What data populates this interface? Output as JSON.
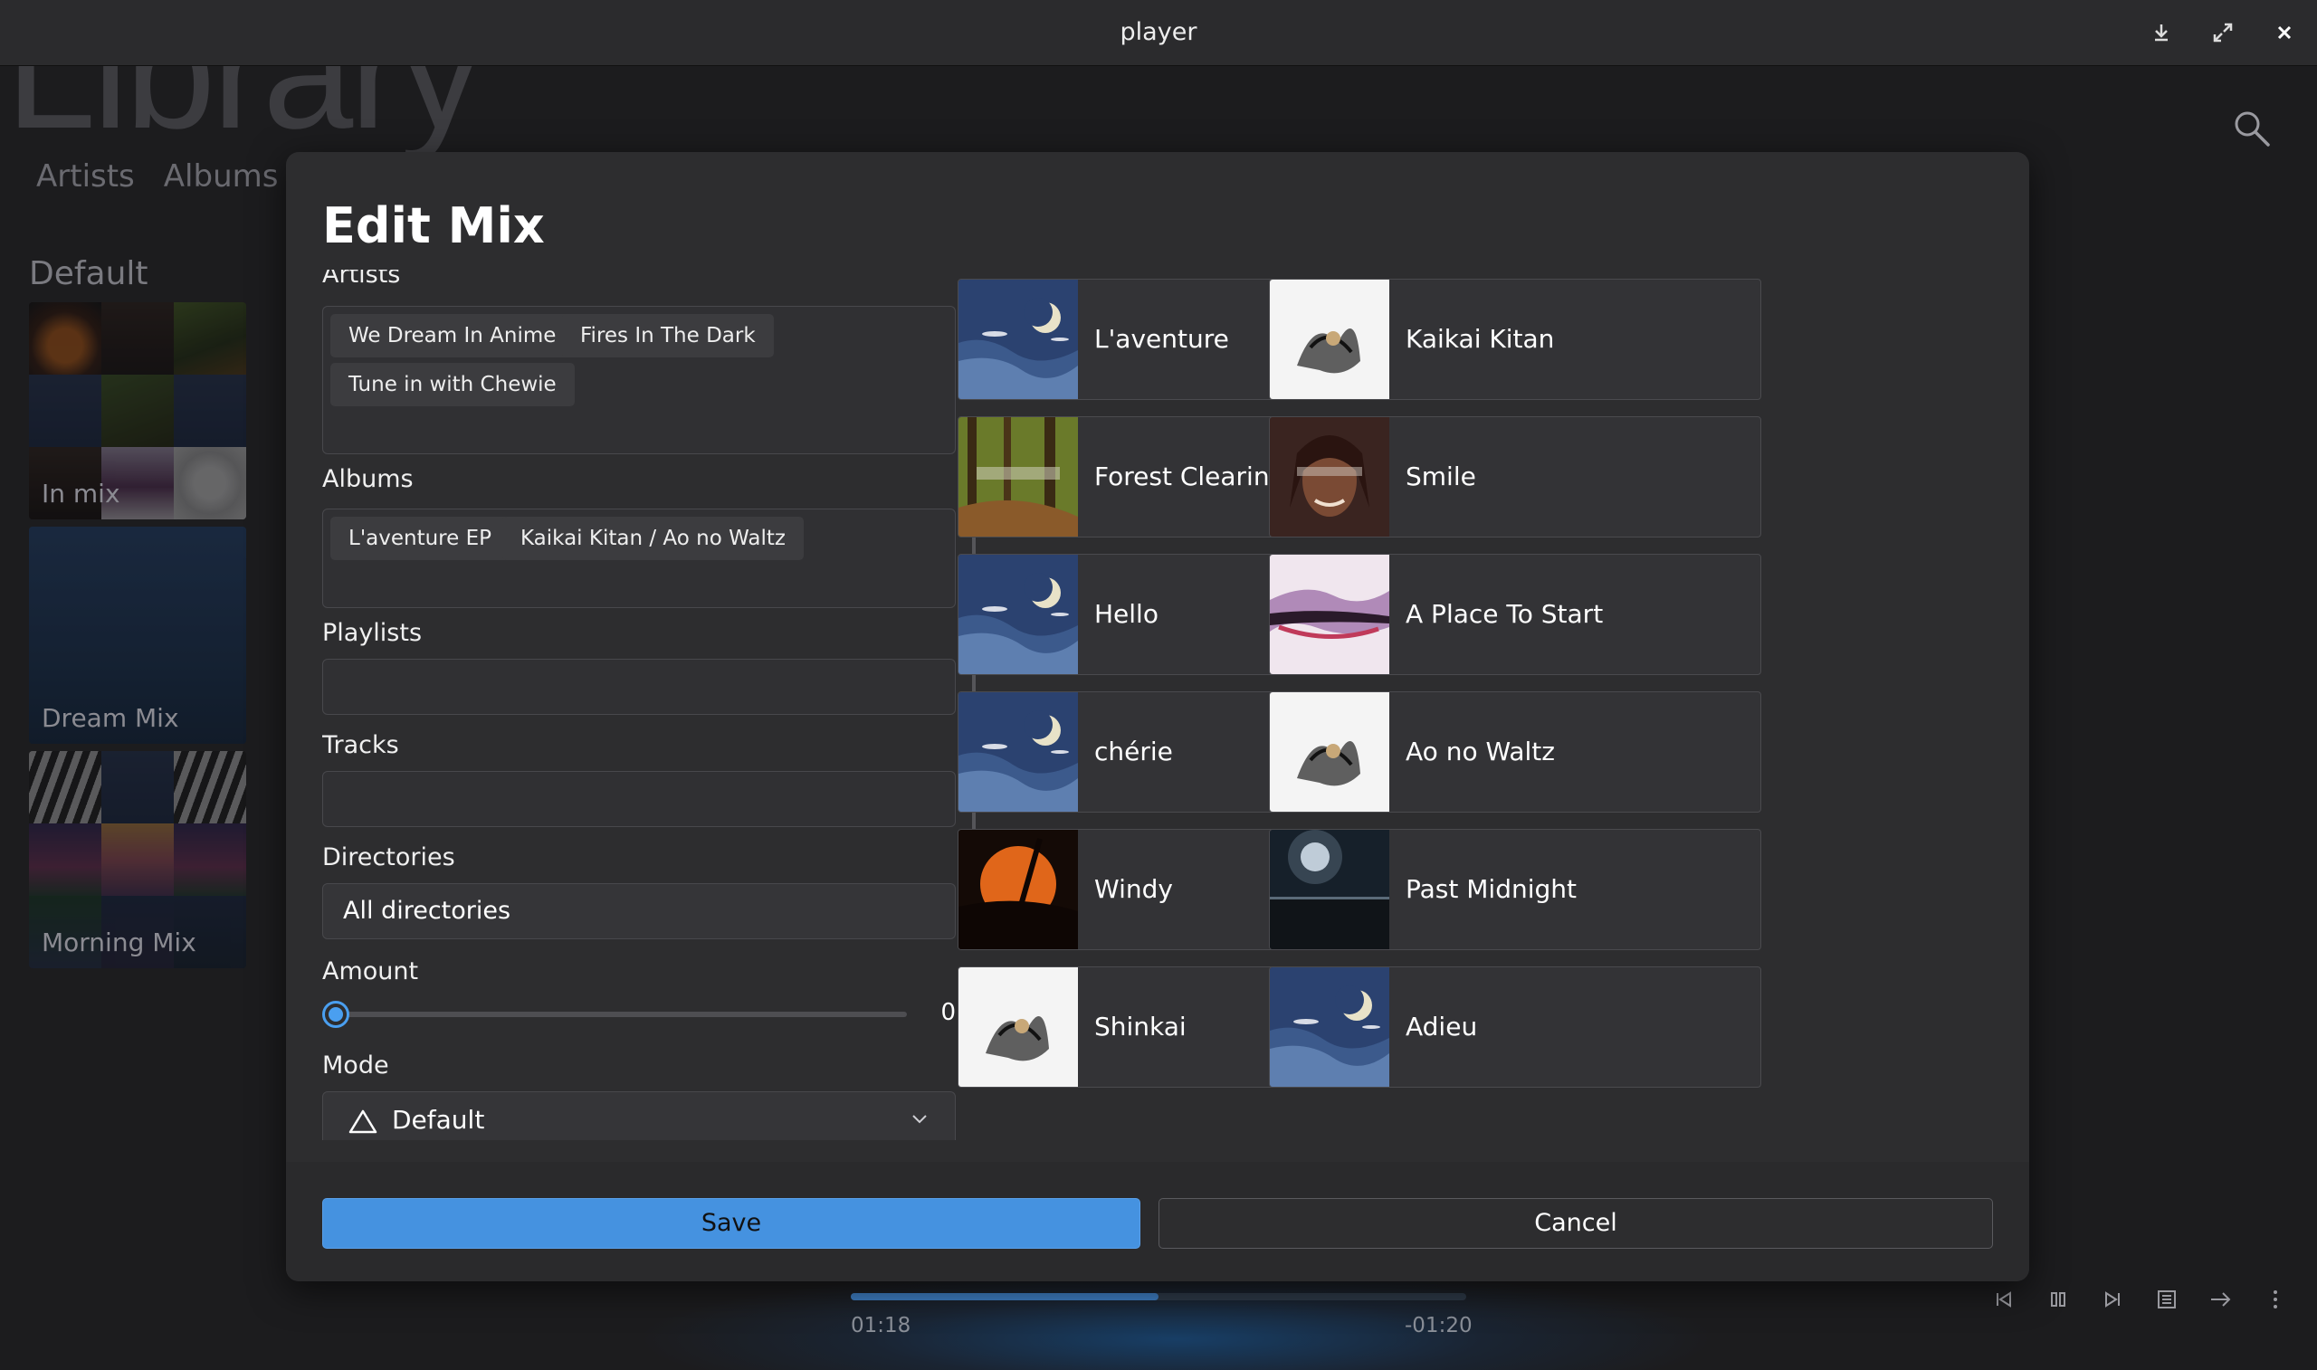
{
  "window": {
    "title": "player"
  },
  "library": {
    "title": "Library",
    "tabs": [
      "Artists",
      "Albums"
    ],
    "section": "Default",
    "mixes": [
      {
        "label": "In mix"
      },
      {
        "label": "Dream Mix"
      },
      {
        "label": "Morning Mix"
      }
    ]
  },
  "player": {
    "elapsed": "01:18",
    "remaining": "-01:20",
    "progress": 0.5
  },
  "dialog": {
    "title": "Edit Mix",
    "artists_label": "Artists",
    "artists": [
      "We Dream In Anime",
      "Fires In The Dark",
      "Tune in with Chewie"
    ],
    "albums_label": "Albums",
    "albums": [
      "L'aventure EP",
      "Kaikai Kitan / Ao no Waltz"
    ],
    "playlists_label": "Playlists",
    "tracks_label": "Tracks",
    "directories_label": "Directories",
    "directories_value": "All directories",
    "amount_label": "Amount",
    "amount_value": "0",
    "mode_label": "Mode",
    "mode_value": "Default",
    "save_label": "Save",
    "cancel_label": "Cancel",
    "tracks": [
      {
        "name": "L'aventure",
        "art": "moon"
      },
      {
        "name": "Kaikai Kitan",
        "art": "ink"
      },
      {
        "name": "Forest Clearing",
        "art": "forest"
      },
      {
        "name": "Smile",
        "art": "portrait"
      },
      {
        "name": "Hello",
        "art": "moon"
      },
      {
        "name": "A Place To Start",
        "art": "watercolor"
      },
      {
        "name": "chérie",
        "art": "moon"
      },
      {
        "name": "Ao no Waltz",
        "art": "ink"
      },
      {
        "name": "Windy",
        "art": "sunset"
      },
      {
        "name": "Past Midnight",
        "art": "night"
      },
      {
        "name": "Shinkai",
        "art": "ink"
      },
      {
        "name": "Adieu",
        "art": "moon"
      }
    ]
  },
  "colors": {
    "accent": "#4592e0",
    "dialog_bg": "#2d2d2f",
    "tile_bg": "#333336"
  }
}
